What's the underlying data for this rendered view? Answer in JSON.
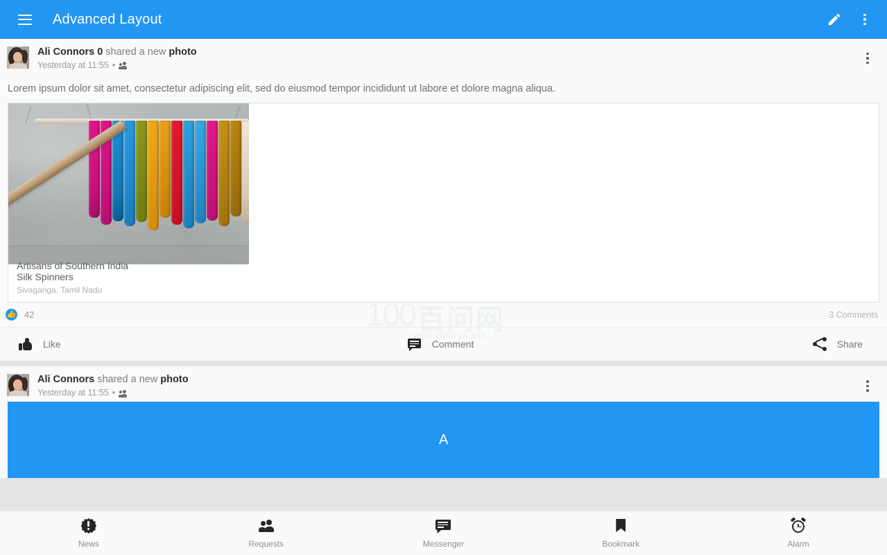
{
  "toolbar": {
    "title": "Advanced Layout",
    "menu_icon": "hamburger-menu-icon",
    "edit_icon": "pencil-edit-icon",
    "overflow_icon": "more-vert-icon",
    "background_color": "#2196f3"
  },
  "watermark": {
    "number": "100",
    "cjk": "百问网",
    "url": "www.100ask.net"
  },
  "posts": [
    {
      "author": "Ali Connors 0",
      "action_text": "shared a new",
      "object": "photo",
      "timestamp": "Yesterday at 11:55",
      "separator": "•",
      "audience_icon": "people-icon",
      "overflow_icon": "more-vert-icon",
      "body": "Lorem ipsum dolor sit amet, consectetur adipiscing elit, sed do eiusmod tempor incididunt ut labore et dolore magna aliqua.",
      "media": {
        "caption_line1": "Artisans of Southern India",
        "caption_line2": "Silk Spinners",
        "caption_line3": "Sivaganga, Tamil Nadu",
        "image_alt": "colorful silk yarn skeins hanging on a wooden pole against a gray wall"
      },
      "stats": {
        "like_icon": "thumb-up-circle-icon",
        "like_count": "42",
        "comments_text": "3 Comments"
      },
      "actions": [
        {
          "label": "Like",
          "icon": "thumb-up-icon"
        },
        {
          "label": "Comment",
          "icon": "comment-icon"
        },
        {
          "label": "Share",
          "icon": "share-icon"
        }
      ]
    },
    {
      "author": "Ali Connors",
      "action_text": "shared a new",
      "object": "photo",
      "timestamp": "Yesterday at 11:55",
      "separator": "•",
      "audience_icon": "people-icon",
      "overflow_icon": "more-vert-icon",
      "placeholder_letter": "A",
      "placeholder_color": "#2196f3"
    }
  ],
  "bottom_nav": [
    {
      "label": "News",
      "icon": "news-badge-icon"
    },
    {
      "label": "Requests",
      "icon": "people-icon"
    },
    {
      "label": "Messenger",
      "icon": "message-icon"
    },
    {
      "label": "Bookmark",
      "icon": "bookmark-icon"
    },
    {
      "label": "Alarm",
      "icon": "alarm-clock-icon"
    }
  ]
}
